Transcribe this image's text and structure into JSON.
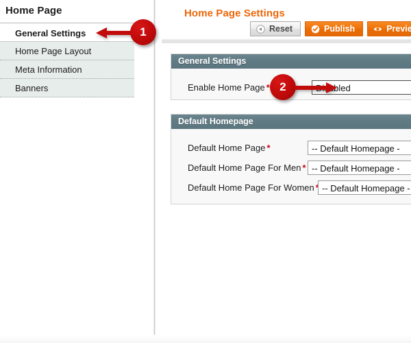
{
  "sidebar": {
    "title": "Home Page",
    "items": [
      {
        "label": "General Settings",
        "selected": true
      },
      {
        "label": "Home Page Layout",
        "selected": false
      },
      {
        "label": "Meta Information",
        "selected": false
      },
      {
        "label": "Banners",
        "selected": false
      }
    ]
  },
  "main": {
    "title": "Home Page Settings",
    "title_color": "#ec6608",
    "toolbar": {
      "reset_label": "Reset",
      "publish_label": "Publish",
      "preview_label": "Preview",
      "reset_icon": "play-back-circle-icon",
      "publish_icon": "check-circle-icon",
      "preview_icon": "eye-icon",
      "accent_color": "#ec6608"
    },
    "panels": [
      {
        "heading": "General Settings",
        "rows": [
          {
            "label": "Enable Home Page",
            "required": "*",
            "control": "text",
            "value": "Disabled"
          }
        ]
      },
      {
        "heading": "Default Homepage",
        "rows": [
          {
            "label": "Default Home Page",
            "required": "*",
            "control": "select",
            "value": "-- Default Homepage -"
          },
          {
            "label": "Default Home Page For Men",
            "required": "*",
            "control": "select",
            "value": "-- Default Homepage -"
          },
          {
            "label": "Default Home Page For Women",
            "required": "*",
            "control": "select",
            "value": "-- Default Homepage -"
          }
        ]
      }
    ]
  },
  "annotations": {
    "marker_color": "#c20b0b",
    "items": [
      {
        "number": "1",
        "points_to": "sidebar-item-general-settings",
        "direction": "left"
      },
      {
        "number": "2",
        "points_to": "enable-home-page-field",
        "direction": "right"
      }
    ]
  }
}
